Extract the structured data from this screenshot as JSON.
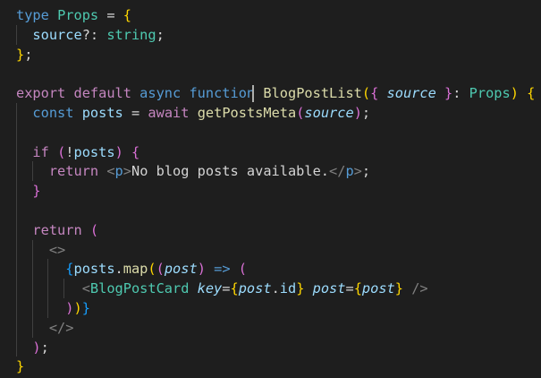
{
  "editor": {
    "theme_background": "#1e1e1e",
    "lines": [
      {
        "tokens": [
          {
            "t": "type",
            "c": "kw"
          },
          {
            "t": " ",
            "c": "punc"
          },
          {
            "t": "Props",
            "c": "type"
          },
          {
            "t": " = ",
            "c": "punc"
          },
          {
            "t": "{",
            "c": "b1"
          }
        ]
      },
      {
        "tokens": [
          {
            "t": "  ",
            "c": "punc"
          },
          {
            "t": "source",
            "c": "var"
          },
          {
            "t": "?: ",
            "c": "punc"
          },
          {
            "t": "string",
            "c": "type"
          },
          {
            "t": ";",
            "c": "punc"
          }
        ]
      },
      {
        "tokens": [
          {
            "t": "}",
            "c": "b1"
          },
          {
            "t": ";",
            "c": "punc"
          }
        ]
      },
      {
        "tokens": []
      },
      {
        "tokens": [
          {
            "t": "export",
            "c": "ctrl"
          },
          {
            "t": " ",
            "c": "punc"
          },
          {
            "t": "default",
            "c": "ctrl"
          },
          {
            "t": " ",
            "c": "punc"
          },
          {
            "t": "async",
            "c": "kw"
          },
          {
            "t": " ",
            "c": "punc"
          },
          {
            "t": "function",
            "c": "kw"
          },
          {
            "t": " ",
            "c": "punc"
          },
          {
            "t": "BlogPostList",
            "c": "fn"
          },
          {
            "t": "(",
            "c": "b1"
          },
          {
            "t": "{",
            "c": "b2"
          },
          {
            "t": " ",
            "c": "punc"
          },
          {
            "t": "source",
            "c": "param"
          },
          {
            "t": " ",
            "c": "punc"
          },
          {
            "t": "}",
            "c": "b2"
          },
          {
            "t": ": ",
            "c": "punc"
          },
          {
            "t": "Props",
            "c": "type"
          },
          {
            "t": ")",
            "c": "b1"
          },
          {
            "t": " ",
            "c": "punc"
          },
          {
            "t": "{",
            "c": "b1"
          }
        ]
      },
      {
        "tokens": [
          {
            "t": "  ",
            "c": "punc"
          },
          {
            "t": "const",
            "c": "kw"
          },
          {
            "t": " ",
            "c": "punc"
          },
          {
            "t": "posts",
            "c": "var"
          },
          {
            "t": " = ",
            "c": "punc"
          },
          {
            "t": "await",
            "c": "ctrl"
          },
          {
            "t": " ",
            "c": "punc"
          },
          {
            "t": "getPostsMeta",
            "c": "fn"
          },
          {
            "t": "(",
            "c": "b2"
          },
          {
            "t": "source",
            "c": "param"
          },
          {
            "t": ")",
            "c": "b2"
          },
          {
            "t": ";",
            "c": "punc"
          }
        ]
      },
      {
        "tokens": []
      },
      {
        "tokens": [
          {
            "t": "  ",
            "c": "punc"
          },
          {
            "t": "if",
            "c": "ctrl"
          },
          {
            "t": " ",
            "c": "punc"
          },
          {
            "t": "(",
            "c": "b2"
          },
          {
            "t": "!",
            "c": "punc"
          },
          {
            "t": "posts",
            "c": "var"
          },
          {
            "t": ")",
            "c": "b2"
          },
          {
            "t": " ",
            "c": "punc"
          },
          {
            "t": "{",
            "c": "b2"
          }
        ]
      },
      {
        "tokens": [
          {
            "t": "    ",
            "c": "punc"
          },
          {
            "t": "return",
            "c": "ctrl"
          },
          {
            "t": " ",
            "c": "punc"
          },
          {
            "t": "<",
            "c": "tag"
          },
          {
            "t": "p",
            "c": "tagname"
          },
          {
            "t": ">",
            "c": "tag"
          },
          {
            "t": "No blog posts available.",
            "c": "text"
          },
          {
            "t": "</",
            "c": "tag"
          },
          {
            "t": "p",
            "c": "tagname"
          },
          {
            "t": ">",
            "c": "tag"
          },
          {
            "t": ";",
            "c": "punc"
          }
        ]
      },
      {
        "tokens": [
          {
            "t": "  ",
            "c": "punc"
          },
          {
            "t": "}",
            "c": "b2"
          }
        ]
      },
      {
        "tokens": []
      },
      {
        "tokens": [
          {
            "t": "  ",
            "c": "punc"
          },
          {
            "t": "return",
            "c": "ctrl"
          },
          {
            "t": " ",
            "c": "punc"
          },
          {
            "t": "(",
            "c": "b2"
          }
        ]
      },
      {
        "tokens": [
          {
            "t": "    ",
            "c": "punc"
          },
          {
            "t": "<>",
            "c": "tag"
          }
        ]
      },
      {
        "tokens": [
          {
            "t": "      ",
            "c": "punc"
          },
          {
            "t": "{",
            "c": "b3"
          },
          {
            "t": "posts",
            "c": "var"
          },
          {
            "t": ".",
            "c": "punc"
          },
          {
            "t": "map",
            "c": "fn"
          },
          {
            "t": "(",
            "c": "b1"
          },
          {
            "t": "(",
            "c": "b2"
          },
          {
            "t": "post",
            "c": "param"
          },
          {
            "t": ")",
            "c": "b2"
          },
          {
            "t": " ",
            "c": "punc"
          },
          {
            "t": "=>",
            "c": "kw"
          },
          {
            "t": " ",
            "c": "punc"
          },
          {
            "t": "(",
            "c": "b2"
          }
        ]
      },
      {
        "tokens": [
          {
            "t": "        ",
            "c": "punc"
          },
          {
            "t": "<",
            "c": "tag"
          },
          {
            "t": "BlogPostCard",
            "c": "comp"
          },
          {
            "t": " ",
            "c": "punc"
          },
          {
            "t": "key",
            "c": "attr"
          },
          {
            "t": "=",
            "c": "punc"
          },
          {
            "t": "{",
            "c": "b1"
          },
          {
            "t": "post",
            "c": "param"
          },
          {
            "t": ".",
            "c": "punc"
          },
          {
            "t": "id",
            "c": "var"
          },
          {
            "t": "}",
            "c": "b1"
          },
          {
            "t": " ",
            "c": "punc"
          },
          {
            "t": "post",
            "c": "attr"
          },
          {
            "t": "=",
            "c": "punc"
          },
          {
            "t": "{",
            "c": "b1"
          },
          {
            "t": "post",
            "c": "param"
          },
          {
            "t": "}",
            "c": "b1"
          },
          {
            "t": " ",
            "c": "punc"
          },
          {
            "t": "/>",
            "c": "tag"
          }
        ]
      },
      {
        "tokens": [
          {
            "t": "      ",
            "c": "punc"
          },
          {
            "t": ")",
            "c": "b2"
          },
          {
            "t": ")",
            "c": "b1"
          },
          {
            "t": "}",
            "c": "b3"
          }
        ]
      },
      {
        "tokens": [
          {
            "t": "    ",
            "c": "punc"
          },
          {
            "t": "</>",
            "c": "tag"
          }
        ]
      },
      {
        "tokens": [
          {
            "t": "  ",
            "c": "punc"
          },
          {
            "t": ")",
            "c": "b2"
          },
          {
            "t": ";",
            "c": "punc"
          }
        ]
      },
      {
        "tokens": [
          {
            "t": "}",
            "c": "b1"
          }
        ]
      }
    ]
  }
}
